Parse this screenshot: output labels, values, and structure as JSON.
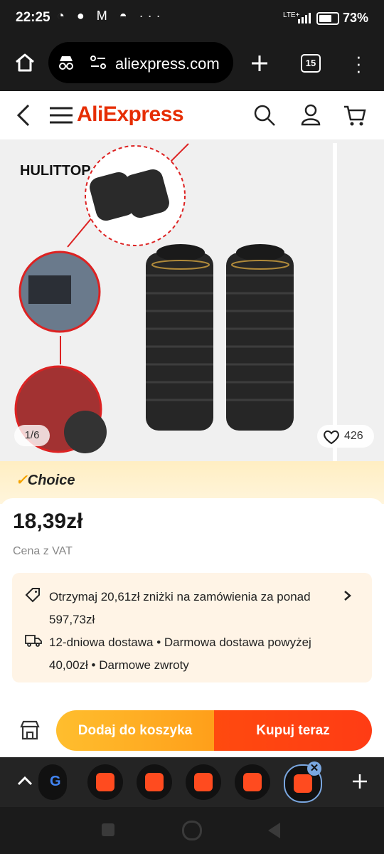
{
  "status_bar": {
    "time": "22:25",
    "network": "LTE+",
    "battery": "73%"
  },
  "browser": {
    "url": "aliexpress.com",
    "tab_count": "15"
  },
  "header": {
    "logo": "AliExpress"
  },
  "gallery": {
    "brand": "HULITTOP",
    "page_indicator": "1/6",
    "likes": "426"
  },
  "choice": {
    "label": "Choice"
  },
  "product": {
    "price": "18,39zł",
    "vat_note": "Cena z VAT",
    "promo_discount": "Otrzymaj 20,61zł zniżki na zamówienia za ponad 597,73zł",
    "promo_delivery": "12-dniowa dostawa • Darmowa dostawa powyżej 40,00zł • Darmowe zwroty"
  },
  "actions": {
    "add_to_cart": "Dodaj do koszyka",
    "buy_now": "Kupuj teraz"
  },
  "colors": {
    "brand": "#e62e04",
    "cart_button": "#ff9f1a",
    "buy_button": "#ff3c14",
    "choice_bg": "#ffeec2"
  }
}
